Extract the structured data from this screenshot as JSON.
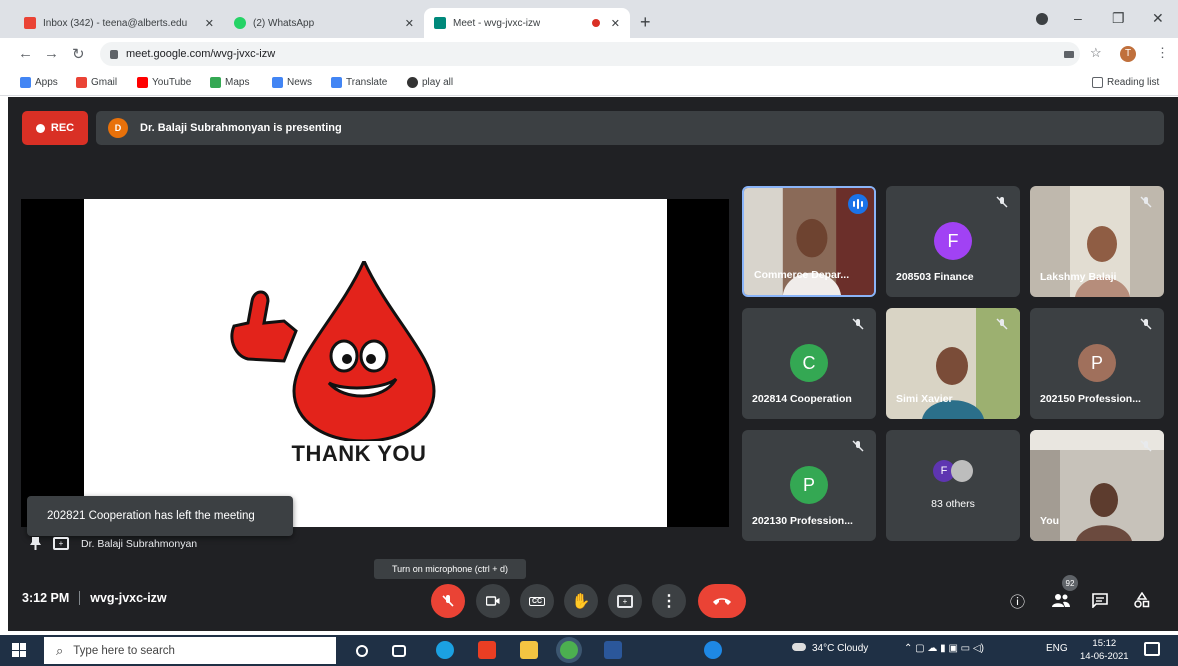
{
  "browser": {
    "tabs": [
      {
        "title": "Inbox (342) - teena@alberts.edu",
        "close": "✕",
        "active": false
      },
      {
        "title": "(2) WhatsApp",
        "close": "✕",
        "active": false
      },
      {
        "title": "Meet - wvg-jvxc-izw",
        "close": "✕",
        "active": true
      }
    ],
    "new_tab": "+",
    "window_controls": {
      "minimize": "–",
      "restore": "❐",
      "close": "✕"
    },
    "address": "meet.google.com/wvg-jvxc-izw",
    "profile_initial": "T",
    "bookmarks": [
      {
        "label": "Apps",
        "icon": "apps-grid-icon",
        "color": "#4285f4"
      },
      {
        "label": "Gmail",
        "icon": "gmail-icon",
        "color": "#ea4335"
      },
      {
        "label": "YouTube",
        "icon": "youtube-icon",
        "color": "#ff0000"
      },
      {
        "label": "Maps",
        "icon": "maps-icon",
        "color": "#34a853"
      },
      {
        "label": "News",
        "icon": "news-icon",
        "color": "#4285f4"
      },
      {
        "label": "Translate",
        "icon": "translate-icon",
        "color": "#4285f4"
      },
      {
        "label": "play all",
        "icon": "github-icon",
        "color": "#333333"
      }
    ],
    "reading_list": "Reading list"
  },
  "meet": {
    "rec_label": "REC",
    "presenting_avatar": "D",
    "presenting_text": "Dr. Balaji Subrahmonyan is presenting",
    "slide_text": "THANK YOU",
    "toast": "202821 Cooperation has left the meeting",
    "presenter_name": "Dr. Balaji Subrahmonyan",
    "tiles": [
      {
        "name": "Commerce Depar...",
        "type": "video"
      },
      {
        "name": "208503 Finance",
        "initial": "F",
        "color": "#a142f4"
      },
      {
        "name": "Lakshmy Balaji",
        "type": "video"
      },
      {
        "name": "202814 Cooperation",
        "initial": "C",
        "color": "#34a853"
      },
      {
        "name": "Simi Xavier",
        "type": "video"
      },
      {
        "name": "202150 Profession...",
        "initial": "P",
        "color": "#a0705c"
      },
      {
        "name": "202130 Profession...",
        "initial": "P",
        "color": "#34a853"
      },
      {
        "name": "83 others",
        "initial": "F"
      },
      {
        "name": "You",
        "type": "video"
      }
    ],
    "tooltip": "Turn on microphone (ctrl + d)",
    "time": "3:12 PM",
    "meeting_code": "wvg-jvxc-izw",
    "participant_count": "92",
    "colors": {
      "accent_red": "#ea4335",
      "bg": "#202124",
      "tile": "#3c4043",
      "speaking": "#8ab4f8"
    }
  },
  "taskbar": {
    "search_placeholder": "Type here to search",
    "weather": "34°C Cloudy",
    "language": "ENG",
    "time": "15:12",
    "date": "14-06-2021"
  }
}
